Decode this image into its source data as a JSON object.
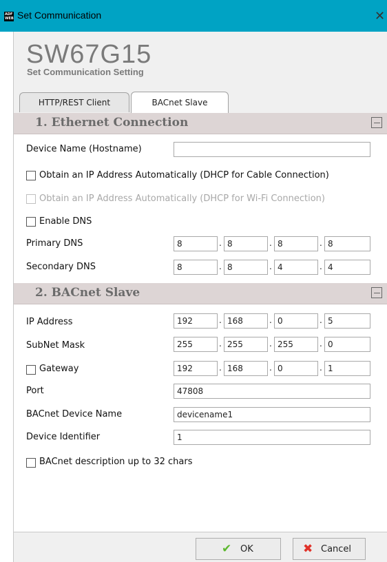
{
  "window": {
    "title": "Set Communication",
    "app_icon_text": "ADF WEB"
  },
  "header": {
    "app_name": "SW67G15",
    "subtitle": "Set Communication Setting"
  },
  "tabs": [
    {
      "label": "HTTP/REST Client",
      "active": false
    },
    {
      "label": "BACnet Slave",
      "active": true
    }
  ],
  "ethernet": {
    "title": "1. Ethernet Connection",
    "device_name_label": "Device Name (Hostname)",
    "device_name_value": "",
    "dhcp_cable_label": "Obtain an IP Address Automatically (DHCP for Cable Connection)",
    "dhcp_cable_checked": false,
    "dhcp_wifi_label": "Obtain an IP Address Automatically (DHCP for Wi-Fi Connection)",
    "dhcp_wifi_checked": false,
    "enable_dns_label": "Enable DNS",
    "enable_dns_checked": false,
    "primary_dns_label": "Primary DNS",
    "primary_dns": [
      "8",
      "8",
      "8",
      "8"
    ],
    "secondary_dns_label": "Secondary DNS",
    "secondary_dns": [
      "8",
      "8",
      "4",
      "4"
    ]
  },
  "bacnet": {
    "title": "2. BACnet Slave",
    "ip_label": "IP Address",
    "ip": [
      "192",
      "168",
      "0",
      "5"
    ],
    "subnet_label": "SubNet Mask",
    "subnet": [
      "255",
      "255",
      "255",
      "0"
    ],
    "gateway_label": "Gateway",
    "gateway_checked": false,
    "gateway": [
      "192",
      "168",
      "0",
      "1"
    ],
    "port_label": "Port",
    "port": "47808",
    "device_name_label": "BACnet Device Name",
    "device_name": "devicename1",
    "device_id_label": "Device Identifier",
    "device_id": "1",
    "desc32_label": "BACnet description up to 32 chars",
    "desc32_checked": false
  },
  "buttons": {
    "ok_label": "OK",
    "cancel_label": "Cancel"
  },
  "icons": {
    "ok_icon": "check-icon",
    "cancel_icon": "x-icon",
    "close_icon": "close-icon"
  },
  "colors": {
    "titlebar": "#00a3c4",
    "section_header": "#ddd5d5",
    "ok_icon": "#5cb82e",
    "cancel_icon": "#e0322a"
  }
}
